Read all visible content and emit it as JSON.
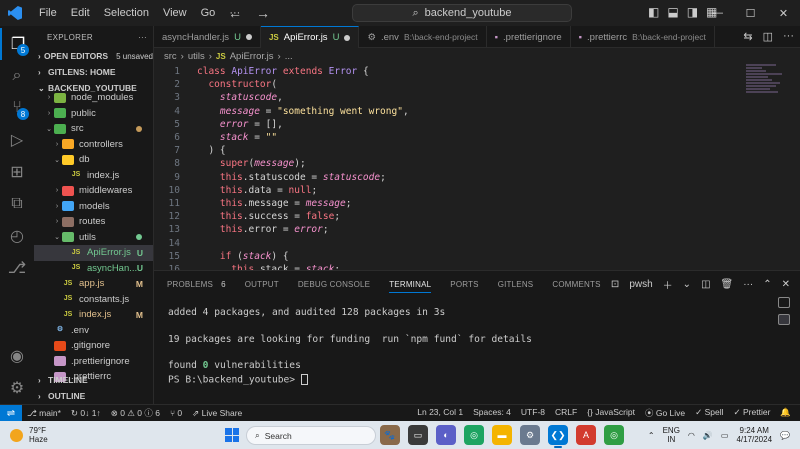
{
  "titlebar": {
    "menu": [
      "File",
      "Edit",
      "Selection",
      "View",
      "Go",
      "···"
    ],
    "search_text": "backend_youtube",
    "window_controls": [
      "—",
      "☐",
      "✕"
    ]
  },
  "activity_badges": {
    "explorer": "5",
    "source_control": "8"
  },
  "sidebar": {
    "title": "EXPLORER",
    "open_editors": {
      "label": "OPEN EDITORS",
      "count": "5 unsaved"
    },
    "gitlens_home": "GITLENS: HOME",
    "project": "BACKEND_YOUTUBE",
    "tree": [
      {
        "label": "node_modules",
        "icon": "folder-node",
        "depth": 1,
        "chevron": "›"
      },
      {
        "label": "public",
        "icon": "folder-public",
        "depth": 1,
        "chevron": "›"
      },
      {
        "label": "src",
        "icon": "folder-src",
        "depth": 1,
        "chevron": "⌄",
        "dot": "#c59a5a"
      },
      {
        "label": "controllers",
        "icon": "folder-controllers",
        "depth": 2,
        "chevron": "›"
      },
      {
        "label": "db",
        "icon": "folder-db",
        "depth": 2,
        "chevron": "⌄"
      },
      {
        "label": "index.js",
        "icon": "js-file",
        "depth": 3,
        "chevron": ""
      },
      {
        "label": "middlewares",
        "icon": "folder-middlewares",
        "depth": 2,
        "chevron": "›"
      },
      {
        "label": "models",
        "icon": "folder-models",
        "depth": 2,
        "chevron": "›"
      },
      {
        "label": "routes",
        "icon": "folder-routes",
        "depth": 2,
        "chevron": "›"
      },
      {
        "label": "utils",
        "icon": "folder-utils",
        "depth": 2,
        "chevron": "⌄",
        "dot": "#73c991"
      },
      {
        "label": "ApiError.js",
        "icon": "js-file",
        "depth": 3,
        "chevron": "",
        "status": "U",
        "status_color": "#73c991",
        "selected": true
      },
      {
        "label": "asyncHan...",
        "icon": "js-file",
        "depth": 3,
        "chevron": "",
        "status": "U",
        "status_color": "#73c991"
      },
      {
        "label": "app.js",
        "icon": "js-file",
        "depth": 2,
        "chevron": "",
        "status": "M",
        "status_color": "#e2c08d"
      },
      {
        "label": "constants.js",
        "icon": "js-file",
        "depth": 2,
        "chevron": ""
      },
      {
        "label": "index.js",
        "icon": "js-file",
        "depth": 2,
        "chevron": "",
        "status": "M",
        "status_color": "#e2c08d"
      },
      {
        "label": ".env",
        "icon": "gear-file",
        "depth": 1,
        "chevron": ""
      },
      {
        "label": ".gitignore",
        "icon": "git-file",
        "depth": 1,
        "chevron": ""
      },
      {
        "label": ".prettierignore",
        "icon": "prettier-file",
        "depth": 1,
        "chevron": ""
      },
      {
        "label": ".prettierrc",
        "icon": "prettier-file",
        "depth": 1,
        "chevron": ""
      }
    ],
    "timeline": "TIMELINE",
    "outline": "OUTLINE"
  },
  "tabs": [
    {
      "label": "asyncHandler.js",
      "status": "U",
      "active": false,
      "dirty": true
    },
    {
      "label": "ApiError.js",
      "status": "U",
      "active": true,
      "dirty": true,
      "js": "JS"
    },
    {
      "label": ".env",
      "path": "B:\\back-end-project",
      "active": false
    },
    {
      "label": ".prettierignore",
      "active": false
    },
    {
      "label": ".prettierrc",
      "path": "B:\\back-end-project",
      "active": false
    }
  ],
  "breadcrumb": [
    "src",
    "›",
    "utils",
    "›",
    "JS",
    "ApiError.js",
    "›",
    "..."
  ],
  "editor": {
    "lines": [
      {
        "n": "1",
        "html": "<span style=\"color:#f97583\">class</span> <span style=\"color:#b392f0\">ApiError</span> <span style=\"color:#f97583\">extends</span> <span style=\"color:#b392f0\">Error</span> {"
      },
      {
        "n": "2",
        "html": "  <span style=\"color:#f97583\">constructor</span>("
      },
      {
        "n": "3",
        "html": "    <span style=\"color:#f692ce;font-style:italic\">statuscode</span>,"
      },
      {
        "n": "4",
        "html": "    <span style=\"color:#f692ce;font-style:italic\">message</span> = <span style=\"color:#fbe09c\">\"something went wrong\"</span>,"
      },
      {
        "n": "5",
        "html": "    <span style=\"color:#f692ce;font-style:italic\">error</span> = [],"
      },
      {
        "n": "6",
        "html": "    <span style=\"color:#f692ce;font-style:italic\">stack</span> = <span style=\"color:#fbe09c\">\"\"</span>"
      },
      {
        "n": "7",
        "html": "  ) {"
      },
      {
        "n": "8",
        "html": "    <span style=\"color:#f97583\">super</span>(<span style=\"color:#f692ce;font-style:italic\">message</span>);"
      },
      {
        "n": "9",
        "html": "    <span style=\"color:#f97583\">this</span>.statuscode = <span style=\"color:#f692ce;font-style:italic\">statuscode</span>;"
      },
      {
        "n": "10",
        "html": "    <span style=\"color:#f97583\">this</span>.data = <span style=\"color:#f97583\">null</span>;"
      },
      {
        "n": "11",
        "html": "    <span style=\"color:#f97583\">this</span>.message = <span style=\"color:#f692ce;font-style:italic\">message</span>;"
      },
      {
        "n": "12",
        "html": "    <span style=\"color:#f97583\">this</span>.success = <span style=\"color:#f97583\">false</span>;"
      },
      {
        "n": "13",
        "html": "    <span style=\"color:#f97583\">this</span>.error = <span style=\"color:#f692ce;font-style:italic\">error</span>;"
      },
      {
        "n": "14",
        "html": ""
      },
      {
        "n": "15",
        "html": "    <span style=\"color:#f97583\">if</span> (<span style=\"color:#f692ce;font-style:italic\">stack</span>) {"
      },
      {
        "n": "16",
        "html": "      <span style=\"color:#f97583\">this</span>.stack = <span style=\"color:#f692ce;font-style:italic\">stack</span>;"
      }
    ]
  },
  "panel": {
    "tabs": [
      {
        "label": "PROBLEMS",
        "count": "6"
      },
      {
        "label": "OUTPUT"
      },
      {
        "label": "DEBUG CONSOLE"
      },
      {
        "label": "TERMINAL",
        "active": true
      },
      {
        "label": "PORTS"
      },
      {
        "label": "GITLENS"
      },
      {
        "label": "COMMENTS"
      }
    ],
    "shell": "pwsh",
    "terminal_lines": [
      "added 4 packages, and audited 128 packages in 3s",
      "19 packages are looking for funding  run `npm fund` for details",
      "found 0 vulnerabilities",
      "PS B:\\backend_youtube> "
    ]
  },
  "statusbar": {
    "left": [
      "main*",
      "↻ 0↓ 1↑",
      "⊗ 0 ⚠ 0 ⓘ 6",
      "⑂ 0",
      "Live Share"
    ],
    "right": [
      "Ln 23, Col 1",
      "Spaces: 4",
      "UTF-8",
      "CRLF",
      "{} JavaScript",
      "Go Live",
      "✓ Spell",
      "✓ Prettier",
      "🔔"
    ]
  },
  "taskbar": {
    "temp": "79°F",
    "weather": "Haze",
    "search_placeholder": "Search",
    "lang": "ENG",
    "region": "IN",
    "time": "9:24 AM",
    "date": "4/17/2024"
  }
}
